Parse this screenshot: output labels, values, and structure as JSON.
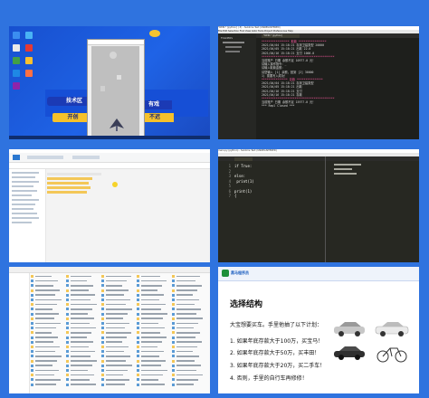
{
  "tile2": {
    "title": "*REPL* [python] (.3) - Sublime Text (UNREGISTERED)",
    "menu": "File  Edit  Selection  Find  View  Goto  Tools  Project  Preferences  Help",
    "folders": "FOLDERS",
    "tab": "*REPL* [python]",
    "lines": [
      "**************** 取款 ****************",
      "2021/04/04 15:18:21    存到卫建类型       20000",
      "2021/04/05 15:18:21    出取          22.0",
      "2021/04/16 15:18:21    支付             1000.0",
      "******************************************",
      "  当前账户   日期   余额不足  10977.0 元！",
      "请输入操作指令：_",
      "请输入取款金额：",
      "请您输入 [1] 余额，回到 [2] 30000",
      "  1) 需要写入成功！",
      "*************** 存款 ***************",
      "2021/04/04 15:18:21    存到卫建类型",
      "2021/04/05 15:18:21    出取",
      "2021/04/16 15:18:21    支付",
      "2021/04/16 15:18:21    存款",
      "******************************************",
      "  当前账户  日期  余额不足  15977.0 元！",
      "",
      "*** Repl Closed ***"
    ]
  },
  "tile4": {
    "title": "main.py (python) - Sublime Text (UNREGISTERED)",
    "code": [
      "if True:",
      "    ",
      "else:",
      "    print(1)",
      "    ",
      "print(1)",
      "{"
    ]
  },
  "tile6": {
    "header_brand": "黑马程序员",
    "title": "选择结构",
    "intro": "大宝想要买车。手里他抽了以下计划：",
    "items": [
      "1. 如果年底存款大于100万，买宝马！",
      "2. 如果年底存款大于50万，买丰田！",
      "3. 如果年底存款大于20万，买二手车！",
      "4. 否则，手里的自行车再修修！"
    ]
  }
}
